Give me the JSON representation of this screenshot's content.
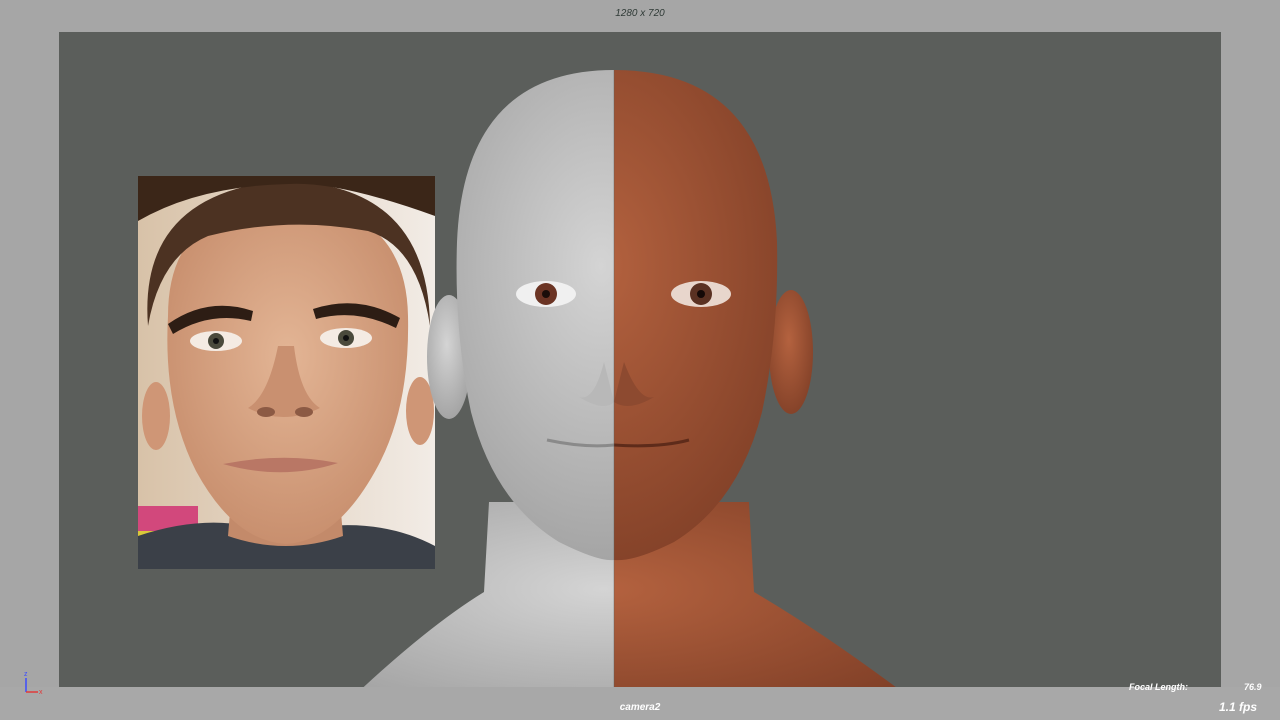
{
  "viewport": {
    "resolution_gate_label": "1280 x 720",
    "camera_name": "camera2",
    "focal_length_label": "Focal Length:",
    "focal_length_value": "76.9",
    "fps_label": "1.1 fps",
    "background_color": "#5b5e5b"
  },
  "axis_gizmo": {
    "z_label": "z",
    "x_label": "x"
  },
  "reference_photo": {
    "description_icon": "reference-face-photo"
  },
  "render": {
    "left_half_shading": "untextured-grey",
    "right_half_shading": "textured-skin"
  }
}
